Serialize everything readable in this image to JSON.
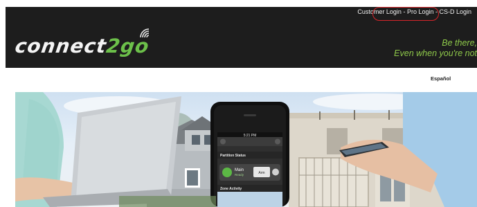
{
  "header": {
    "login_links": {
      "customer": "Customer Login",
      "pro": "Pro Login",
      "csd": "CS-D Login",
      "separator": " - "
    },
    "logo": {
      "text_main": "connect",
      "text_accent": "2go",
      "icon": "wifi-signal-icon"
    },
    "tagline": {
      "line1": "Be there,",
      "line2": "Even when you're not"
    }
  },
  "language_link": "Español",
  "hero": {
    "phone": {
      "time": "5:21 PM",
      "partition_status": "Partition Status",
      "device_name": "Main",
      "device_state": "Ready",
      "arm_label": "Arm",
      "zone_activity": "Zone Activity"
    }
  },
  "colors": {
    "header_bg": "#1d1d1d",
    "accent_green": "#6cc04a",
    "highlight_red": "#d8262b"
  }
}
